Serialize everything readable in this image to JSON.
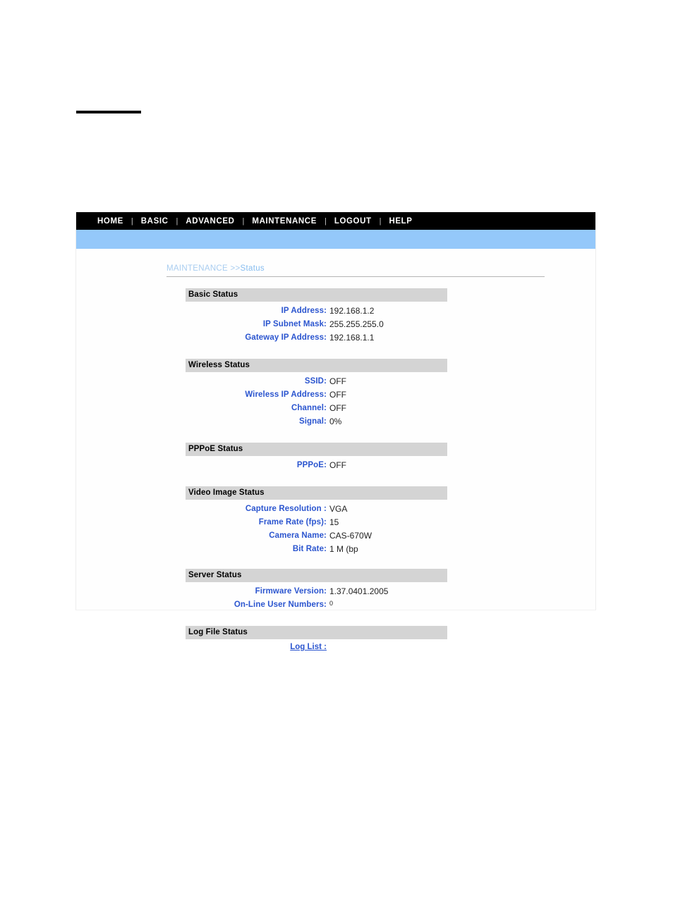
{
  "nav": {
    "separator": "|",
    "items": [
      {
        "label": "HOME"
      },
      {
        "label": "BASIC"
      },
      {
        "label": "ADVANCED"
      },
      {
        "label": "MAINTENANCE"
      },
      {
        "label": "LOGOUT"
      },
      {
        "label": "HELP"
      }
    ]
  },
  "breadcrumb": {
    "parent": "MAINTENANCE",
    "separator": " >>",
    "current": "Status"
  },
  "sections": [
    {
      "title": "Basic Status",
      "rows": [
        {
          "label": "IP Address:",
          "value": "192.168.1.2"
        },
        {
          "label": "IP Subnet Mask:",
          "value": "255.255.255.0"
        },
        {
          "label": "Gateway IP Address:",
          "value": "192.168.1.1"
        }
      ]
    },
    {
      "title": "Wireless Status",
      "rows": [
        {
          "label": "SSID:",
          "value": "OFF"
        },
        {
          "label": "Wireless IP Address:",
          "value": "OFF"
        },
        {
          "label": "Channel:",
          "value": "OFF"
        },
        {
          "label": "Signal:",
          "value": "0%"
        }
      ]
    },
    {
      "title": "PPPoE Status",
      "rows": [
        {
          "label": "PPPoE:",
          "value": "OFF"
        }
      ]
    },
    {
      "title": "Video Image Status",
      "rows": [
        {
          "label": "Capture Resolution :",
          "value": "VGA"
        },
        {
          "label": "Frame Rate (fps):",
          "value": "15"
        },
        {
          "label": "Camera Name:",
          "value": "CAS-670W"
        },
        {
          "label": "Bit Rate:",
          "value": "1 M (bp"
        }
      ]
    },
    {
      "title": "Server Status",
      "rows": [
        {
          "label": "Firmware Version:",
          "value": "1.37.0401.2005"
        },
        {
          "label": "On-Line User Numbers:",
          "value": "0",
          "superscript": true
        }
      ]
    },
    {
      "title": "Log File Status",
      "link": "Log List :"
    }
  ],
  "colors": {
    "nav_background": "#000000",
    "nav_text": "#ffffff",
    "band_blue": "#94c8fa",
    "section_header_background": "#d4d4d4",
    "label_blue": "#2b55cf",
    "breadcrumb_blue": "#a9cdf0"
  }
}
